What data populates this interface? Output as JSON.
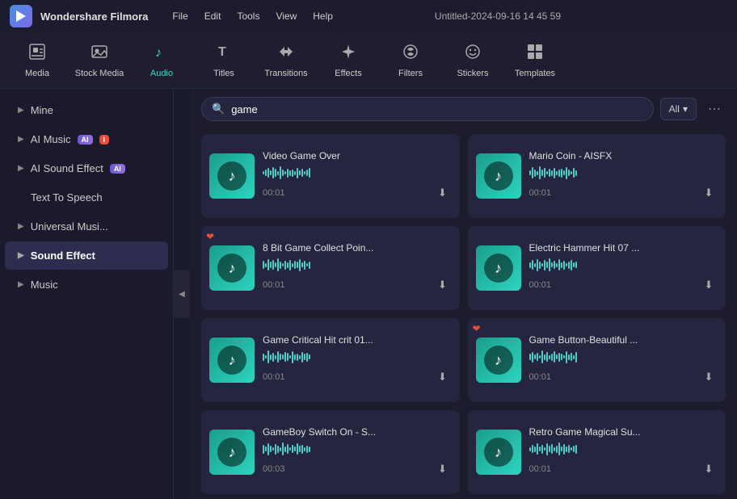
{
  "titleBar": {
    "appName": "Wondershare Filmora",
    "logoText": "F",
    "menuItems": [
      "File",
      "Edit",
      "Tools",
      "View",
      "Help"
    ],
    "windowTitle": "Untitled-2024-09-16 14 45 59"
  },
  "toolbar": {
    "items": [
      {
        "id": "media",
        "label": "Media",
        "icon": "⬛"
      },
      {
        "id": "stock-media",
        "label": "Stock Media",
        "icon": "🎬"
      },
      {
        "id": "audio",
        "label": "Audio",
        "icon": "♫",
        "active": true
      },
      {
        "id": "titles",
        "label": "Titles",
        "icon": "T"
      },
      {
        "id": "transitions",
        "label": "Transitions",
        "icon": "↔"
      },
      {
        "id": "effects",
        "label": "Effects",
        "icon": "✦"
      },
      {
        "id": "filters",
        "label": "Filters",
        "icon": "⬡"
      },
      {
        "id": "stickers",
        "label": "Stickers",
        "icon": "❋"
      },
      {
        "id": "templates",
        "label": "Templates",
        "icon": "⊞"
      }
    ]
  },
  "sidebar": {
    "items": [
      {
        "id": "mine",
        "label": "Mine",
        "hasArrow": true,
        "indent": 0
      },
      {
        "id": "ai-music",
        "label": "AI Music",
        "hasBadgeAI": true,
        "hasBadgeNew": true,
        "hasArrow": true,
        "indent": 0
      },
      {
        "id": "ai-sound-effect",
        "label": "AI Sound Effect",
        "hasBadgeAI": true,
        "hasArrow": true,
        "indent": 0
      },
      {
        "id": "text-to-speech",
        "label": "Text To Speech",
        "indent": 1
      },
      {
        "id": "universal-music",
        "label": "Universal Musi...",
        "hasArrow": true,
        "indent": 0
      },
      {
        "id": "sound-effect",
        "label": "Sound Effect",
        "active": true,
        "hasArrow": true,
        "indent": 0
      },
      {
        "id": "music",
        "label": "Music",
        "hasArrow": true,
        "indent": 0
      }
    ]
  },
  "search": {
    "placeholder": "game",
    "value": "game",
    "filterLabel": "All",
    "filterIcon": "▾"
  },
  "audioGrid": {
    "items": [
      {
        "id": "video-game-over",
        "title": "Video Game Over",
        "duration": "00:01",
        "hasBadge": false
      },
      {
        "id": "mario-coin",
        "title": "Mario Coin - AISFX",
        "duration": "00:01",
        "hasBadge": false
      },
      {
        "id": "8bit-collect",
        "title": "8 Bit Game Collect Poin...",
        "duration": "00:01",
        "hasBadge": true
      },
      {
        "id": "electric-hammer",
        "title": "Electric Hammer Hit 07 ...",
        "duration": "00:01",
        "hasBadge": false
      },
      {
        "id": "game-critical-hit",
        "title": "Game Critical Hit crit 01...",
        "duration": "00:01",
        "hasBadge": false
      },
      {
        "id": "game-button-beautiful",
        "title": "Game Button-Beautiful ...",
        "duration": "00:01",
        "hasBadge": true
      },
      {
        "id": "gameboy-switch",
        "title": "GameBoy Switch On - S...",
        "duration": "00:03",
        "hasBadge": false
      },
      {
        "id": "retro-game-magical",
        "title": "Retro Game Magical Su...",
        "duration": "00:01",
        "hasBadge": false
      }
    ]
  },
  "colors": {
    "accent": "#4ecdc4",
    "activeTab": "#4ecdc4",
    "badgeAI": "#7b68ee",
    "heart": "#e74c3c"
  }
}
